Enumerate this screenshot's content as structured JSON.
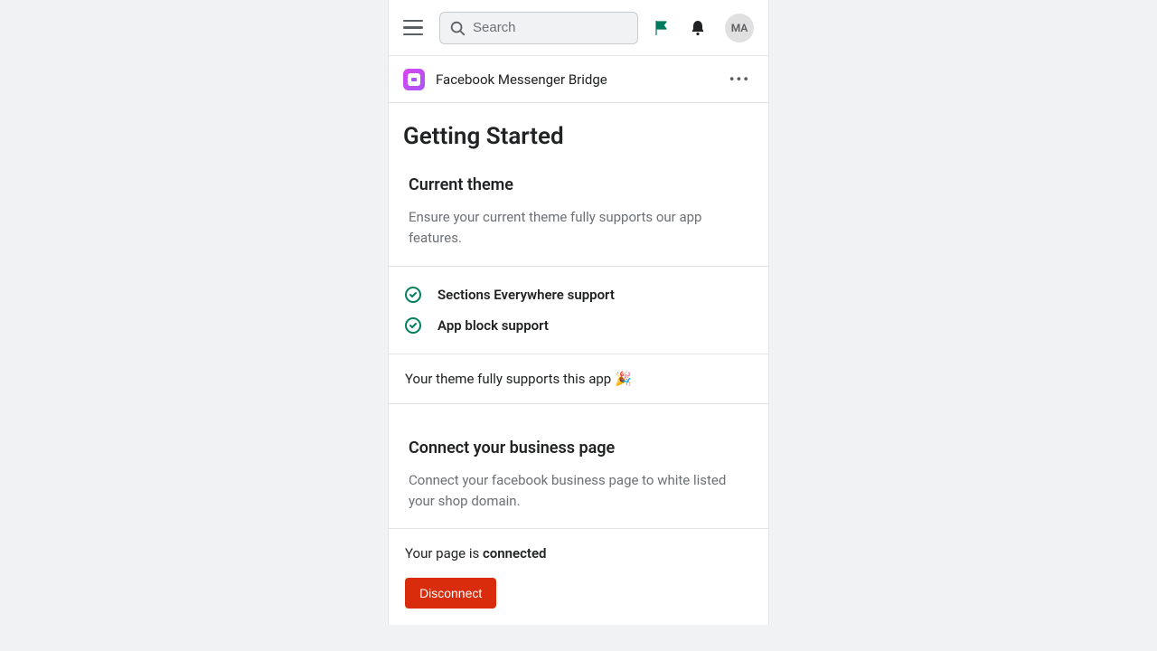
{
  "topbar": {
    "search_placeholder": "Search",
    "avatar_initials": "MA"
  },
  "app": {
    "name": "Facebook Messenger Bridge"
  },
  "page": {
    "title": "Getting Started"
  },
  "theme_section": {
    "title": "Current theme",
    "description": "Ensure your current theme fully supports our app features.",
    "items": [
      {
        "label": "Sections Everywhere support"
      },
      {
        "label": "App block support"
      }
    ],
    "footer": "Your theme fully supports this app 🎉"
  },
  "connect_section": {
    "title": "Connect your business page",
    "description": "Connect your facebook business page to white listed your shop domain.",
    "status_prefix": "Your page is ",
    "status_value": "connected",
    "disconnect_label": "Disconnect"
  }
}
